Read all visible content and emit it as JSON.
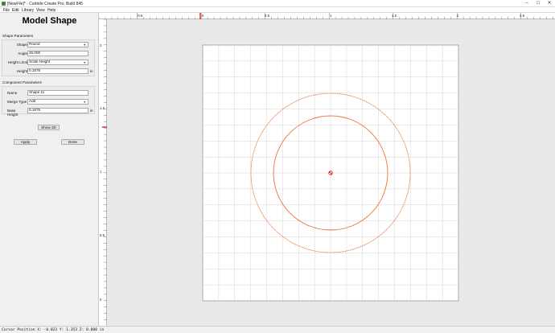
{
  "window": {
    "title": "[NewFile]* - Carbide Create Pro, Build 845",
    "controls": {
      "minimize": "–",
      "maximize": "☐",
      "close": "✕"
    }
  },
  "menu": [
    "File",
    "Edit",
    "Library",
    "View",
    "Help"
  ],
  "panel": {
    "title": "Model Shape",
    "shape_params": {
      "heading": "Shape Parameters",
      "shape_label": "Shape",
      "shape_value": "Round",
      "angle_label": "Angle",
      "angle_value": "45.000",
      "height_limit_label": "Height Limit",
      "height_limit_value": "Scale Height",
      "height_label": "Height",
      "height_value": "0.1875",
      "height_unit": "in"
    },
    "component_params": {
      "heading": "Component Parameters",
      "name_label": "Name",
      "name_value": "Shape 11",
      "merge_label": "Merge Type",
      "merge_value": "Add",
      "base_label": "Base Height",
      "base_value": "0.1875",
      "base_unit": "in"
    },
    "show3d_label": "Show 3D",
    "apply_label": "Apply",
    "done_label": "Done"
  },
  "ruler": {
    "top": [
      "-0.5",
      "0",
      "0.5",
      "1",
      "1.5",
      "2",
      "2.5"
    ],
    "left": [
      "2",
      "1.5",
      "1",
      "0.5",
      "0"
    ]
  },
  "colors": {
    "shape_stroke": "#e8743a",
    "origin_marker": "#e00000",
    "grid": "#d4d4d4"
  },
  "status": "Cursor Position X: -0.023 Y: 1.353 Z: 0.000 in"
}
